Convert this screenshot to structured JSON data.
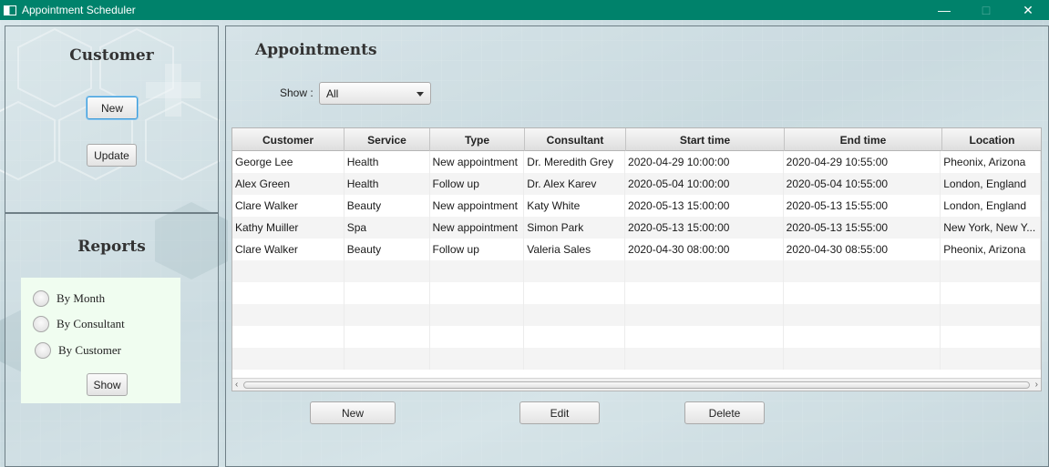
{
  "window": {
    "title": "Appointment Scheduler",
    "controls": {
      "minimize": "—",
      "maximize": "□",
      "close": "✕"
    }
  },
  "customer_panel": {
    "title": "Customer",
    "new_label": "New",
    "update_label": "Update"
  },
  "reports_panel": {
    "title": "Reports",
    "options": [
      "By Month",
      "By Consultant",
      "By Customer"
    ],
    "show_label": "Show"
  },
  "appointments": {
    "title": "Appointments",
    "filter": {
      "label": "Show :",
      "selected": "All"
    },
    "columns": [
      "Customer",
      "Service",
      "Type",
      "Consultant",
      "Start time",
      "End time",
      "Location"
    ],
    "rows": [
      [
        "George Lee",
        "Health",
        "New appointment",
        "Dr. Meredith Grey",
        "2020-04-29 10:00:00",
        "2020-04-29 10:55:00",
        "Pheonix, Arizona"
      ],
      [
        "Alex Green",
        "Health",
        "Follow up",
        "Dr. Alex Karev",
        "2020-05-04 10:00:00",
        "2020-05-04 10:55:00",
        "London, England"
      ],
      [
        "Clare Walker",
        "Beauty",
        "New appointment",
        "Katy White",
        "2020-05-13 15:00:00",
        "2020-05-13 15:55:00",
        "London, England"
      ],
      [
        "Kathy Muiller",
        "Spa",
        "New appointment",
        "Simon Park",
        "2020-05-13 15:00:00",
        "2020-05-13 15:55:00",
        "New York, New Y..."
      ],
      [
        "Clare Walker",
        "Beauty",
        "Follow up",
        "Valeria Sales",
        "2020-04-30 08:00:00",
        "2020-04-30 08:55:00",
        "Pheonix, Arizona"
      ]
    ],
    "new_label": "New",
    "edit_label": "Edit",
    "delete_label": "Delete"
  },
  "colors": {
    "titlebar": "#00826b",
    "reports_box": "#f0fdf0",
    "focus": "#3a9bd9"
  }
}
